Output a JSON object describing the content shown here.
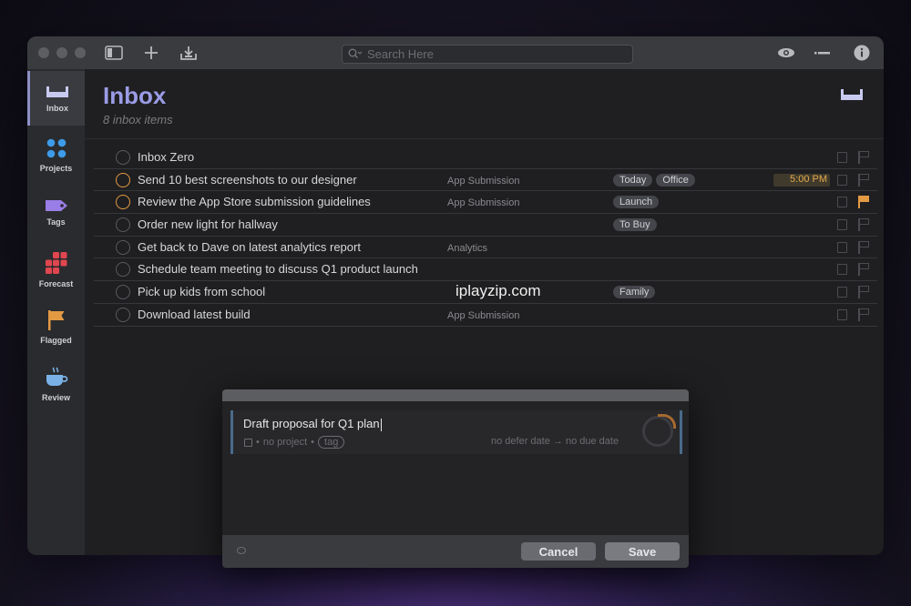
{
  "toolbar": {
    "search_placeholder": "Search Here"
  },
  "sidebar": {
    "items": [
      {
        "label": "Inbox",
        "icon": "inbox-icon",
        "color": "#8d8fc7"
      },
      {
        "label": "Projects",
        "icon": "projects-icon",
        "color": "#3d9be9"
      },
      {
        "label": "Tags",
        "icon": "tag-icon",
        "color": "#9a7ee8"
      },
      {
        "label": "Forecast",
        "icon": "forecast-icon",
        "color": "#e0464f"
      },
      {
        "label": "Flagged",
        "icon": "flag-icon",
        "color": "#e39a43"
      },
      {
        "label": "Review",
        "icon": "review-icon",
        "color": "#7ab2e8"
      }
    ]
  },
  "header": {
    "title": "Inbox",
    "subtitle": "8 inbox items"
  },
  "tasks": [
    {
      "title": "Inbox Zero",
      "project": "",
      "tags": [],
      "due": "",
      "orange": false,
      "flagged": false
    },
    {
      "title": "Send 10 best screenshots to our designer",
      "project": "App Submission",
      "tags": [
        "Today",
        "Office"
      ],
      "due": "5:00 PM",
      "orange": true,
      "flagged": false
    },
    {
      "title": "Review the App Store submission guidelines",
      "project": "App Submission",
      "tags": [
        "Launch"
      ],
      "due": "",
      "orange": true,
      "flagged": true
    },
    {
      "title": "Order new light for hallway",
      "project": "",
      "tags": [
        "To Buy"
      ],
      "due": "",
      "orange": false,
      "flagged": false
    },
    {
      "title": "Get back to Dave on latest analytics report",
      "project": "Analytics",
      "tags": [],
      "due": "",
      "orange": false,
      "flagged": false
    },
    {
      "title": "Schedule team meeting to discuss Q1 product launch",
      "project": "",
      "tags": [],
      "due": "",
      "orange": false,
      "flagged": false
    },
    {
      "title": "Pick up kids from school",
      "project": "",
      "tags": [
        "Family"
      ],
      "due": "",
      "orange": false,
      "flagged": false
    },
    {
      "title": "Download latest build",
      "project": "App Submission",
      "tags": [],
      "due": "",
      "orange": false,
      "flagged": false
    }
  ],
  "watermark": "iplayzip.com",
  "quick_entry": {
    "title": "Draft proposal for Q1 plan",
    "no_project": "no project",
    "tag": "tag",
    "defer": "no defer date",
    "arrow": "→",
    "due": "no due date",
    "cancel_label": "Cancel",
    "save_label": "Save"
  }
}
